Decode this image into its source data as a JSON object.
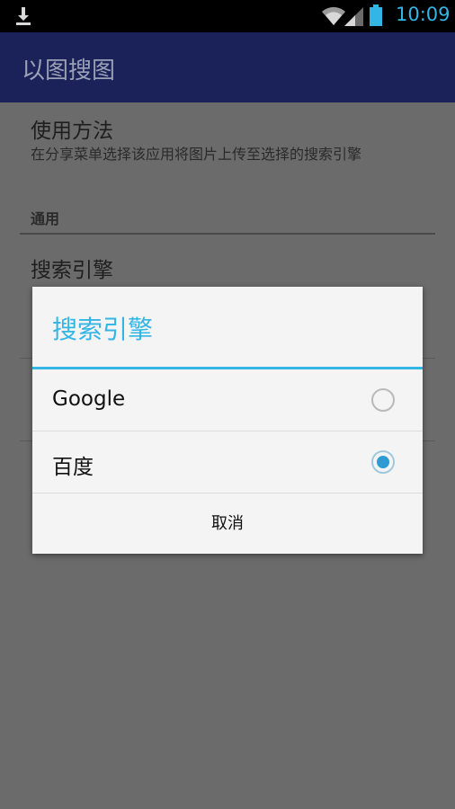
{
  "status_bar": {
    "time": "10:09",
    "icons": [
      "download-icon",
      "wifi-icon",
      "signal-icon",
      "battery-icon"
    ],
    "time_color": "#33b5e5"
  },
  "app_bar": {
    "title": "以图搜图",
    "background": "#1b2159"
  },
  "preferences": {
    "usage_title": "使用方法",
    "usage_summary": "在分享菜单选择该应用将图片上传至选择的搜索引擎",
    "category_general": "通用",
    "engine_title": "搜索引擎"
  },
  "dialog": {
    "title": "搜索引擎",
    "accent": "#33b5e5",
    "options": [
      {
        "label": "Google",
        "selected": false
      },
      {
        "label": "百度",
        "selected": true
      }
    ],
    "cancel_label": "取消"
  }
}
